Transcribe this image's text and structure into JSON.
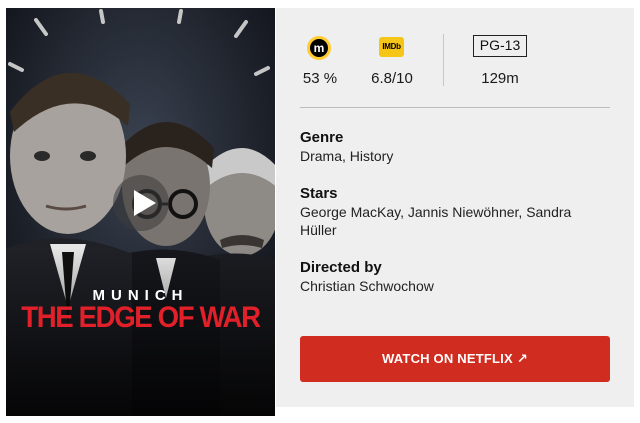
{
  "poster": {
    "kicker": "MUNICH",
    "title": "THE EDGE OF WAR"
  },
  "ratings": {
    "metacritic": {
      "icon": "metacritic-icon",
      "icon_text": "m",
      "value": "53 %"
    },
    "imdb": {
      "icon": "imdb-icon",
      "icon_text": "IMDb",
      "value": "6.8/10"
    },
    "certificate": {
      "badge": "PG-13",
      "runtime": "129m"
    }
  },
  "info": {
    "genre_label": "Genre",
    "genre_value": "Drama, History",
    "stars_label": "Stars",
    "stars_value": "George MacKay, Jannis Niewöhner, Sandra Hüller",
    "director_label": "Directed by",
    "director_value": "Christian Schwochow"
  },
  "cta": {
    "label": "WATCH ON NETFLIX",
    "icon": "external-arrow-icon",
    "color": "#d02c20"
  },
  "colors": {
    "panel_bg": "#efefef",
    "poster_title_red": "#e2202a",
    "metacritic_yellow": "#ffcc33",
    "imdb_yellow": "#f5c518"
  }
}
